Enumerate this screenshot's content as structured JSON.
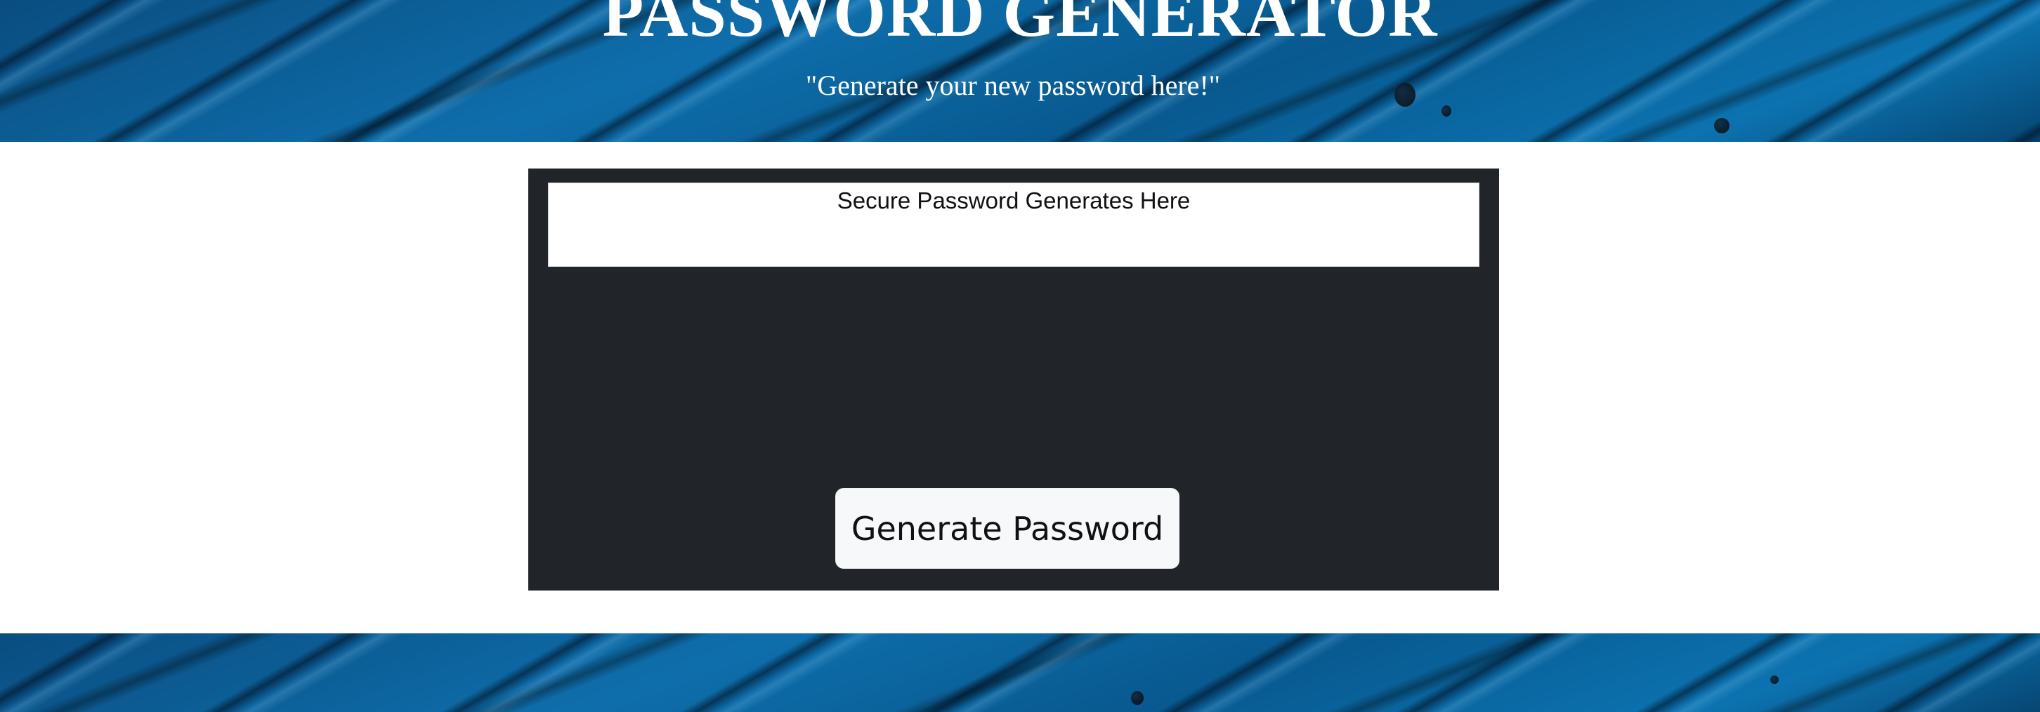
{
  "header": {
    "title": "PASSWORD GENERATOR",
    "subtitle": "\"Generate your new password here!\""
  },
  "card": {
    "password_placeholder": "Secure Password Generates Here",
    "password_value": "",
    "generate_label": "Generate Password"
  },
  "colors": {
    "background_accent": "#0e6eab",
    "card_background": "#212428",
    "button_background": "#f7f8fa",
    "page_background": "#ffffff"
  }
}
